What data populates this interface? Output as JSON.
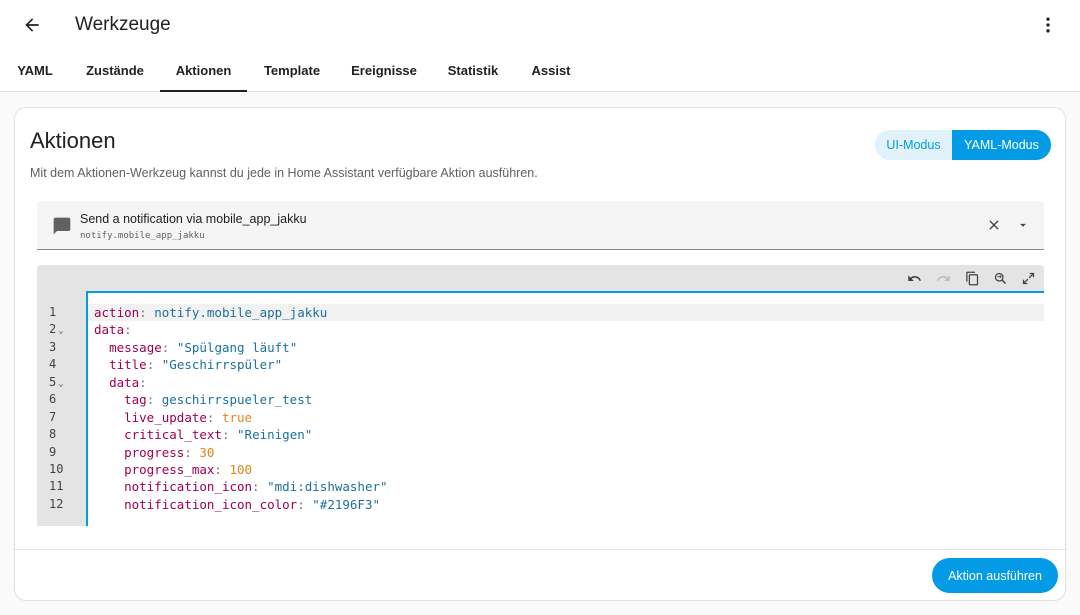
{
  "header": {
    "title": "Werkzeuge",
    "back_icon": "arrow-left-icon",
    "more_icon": "dots-vertical-icon"
  },
  "tabs": [
    {
      "label": "YAML",
      "active": false
    },
    {
      "label": "Zustände",
      "active": false
    },
    {
      "label": "Aktionen",
      "active": true
    },
    {
      "label": "Template",
      "active": false
    },
    {
      "label": "Ereignisse",
      "active": false
    },
    {
      "label": "Statistik",
      "active": false
    },
    {
      "label": "Assist",
      "active": false
    }
  ],
  "card": {
    "title": "Aktionen",
    "description": "Mit dem Aktionen-Werkzeug kannst du jede in Home Assistant verfügbare Aktion ausführen.",
    "mode_ui_label": "UI-Modus",
    "mode_yaml_label": "YAML-Modus",
    "active_mode": "YAML-Modus"
  },
  "action_selector": {
    "name": "Send a notification via mobile_app_jakku",
    "id": "notify.mobile_app_jakku",
    "icon": "message-icon"
  },
  "editor": {
    "toolbar_icons": [
      "undo-icon",
      "redo-icon",
      "copy-icon",
      "search-replace-icon",
      "fullscreen-icon"
    ],
    "line_numbers": [
      "1",
      "2",
      "3",
      "4",
      "5",
      "6",
      "7",
      "8",
      "9",
      "10",
      "11",
      "12"
    ],
    "lines": [
      {
        "key": "action",
        "value": "notify.mobile_app_jakku"
      },
      {
        "key": "data",
        "value": ""
      },
      {
        "key": "message",
        "value": "\"Spülgang läuft\""
      },
      {
        "key": "title",
        "value": "\"Geschirrspüler\""
      },
      {
        "key": "data",
        "value": ""
      },
      {
        "key": "tag",
        "value": "geschirrspueler_test"
      },
      {
        "key": "live_update",
        "value": "true"
      },
      {
        "key": "critical_text",
        "value": "\"Reinigen\""
      },
      {
        "key": "progress",
        "value": "30"
      },
      {
        "key": "progress_max",
        "value": "100"
      },
      {
        "key": "notification_icon",
        "value": "\"mdi:dishwasher\""
      },
      {
        "key": "notification_icon_color",
        "value": "\"#2196F3\""
      }
    ]
  },
  "footer": {
    "run_label": "Aktion ausführen"
  },
  "colors": {
    "accent": "#039be5",
    "accent_light": "#e1f2fb",
    "yaml_key": "#a0004f",
    "yaml_string": "#1d6f9f",
    "yaml_number": "#e0861b"
  }
}
